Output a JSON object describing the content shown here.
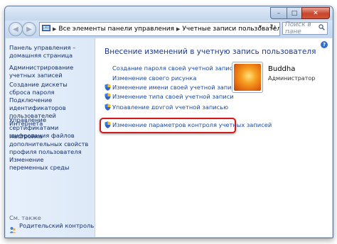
{
  "nav": {
    "back_icon": "back-arrow-icon",
    "forward_icon": "forward-arrow-icon",
    "refresh_glyph": "↻",
    "dropdown_glyph": "▾",
    "search_placeholder": "Поиск в пане",
    "breadcrumb": [
      "Все элементы панели управления",
      "Учетные записи пользователей"
    ]
  },
  "sidebar": {
    "links": [
      "Панель управления – домашняя страница",
      "Администрирование учетных записей",
      "Создание дискеты сброса пароля",
      "Подключение идентификаторов пользователей Интернета",
      "Управление сертификатами шифрования файлов",
      "Настройка дополнительных свойств профиля пользователя",
      "Изменение переменных среды"
    ],
    "see_also_label": "См. также",
    "see_also_link": "Родительский контроль"
  },
  "main": {
    "heading": "Внесение изменений в учетную запись пользователя",
    "links": [
      "Создание пароля своей учетной записи",
      "Изменение своего рисунка",
      "Изменение имени своей учетной записи",
      "Изменение типа своей учетной записи",
      "Управление другой учетной записью",
      "Изменение параметров контроля учетных записей"
    ],
    "user": {
      "name": "Buddha",
      "role": "Администратор"
    },
    "help_glyph": "?"
  },
  "window": {
    "minimize_glyph": "–",
    "maximize_glyph": "□",
    "close_glyph": "✕"
  },
  "colors": {
    "highlight": "#d21a1a",
    "link": "#1a4aa0"
  }
}
